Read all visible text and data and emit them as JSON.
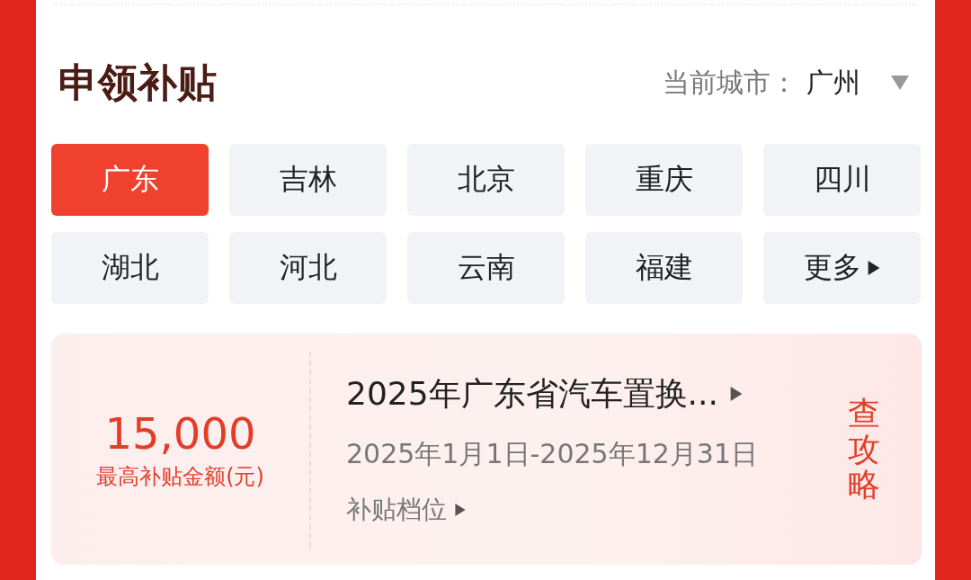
{
  "header": {
    "title": "申领补贴",
    "city_label": "当前城市：",
    "city": "广州"
  },
  "regions": [
    {
      "label": "广东",
      "kind": "region",
      "selected": true
    },
    {
      "label": "吉林",
      "kind": "region",
      "selected": false
    },
    {
      "label": "北京",
      "kind": "region",
      "selected": false
    },
    {
      "label": "重庆",
      "kind": "region",
      "selected": false
    },
    {
      "label": "四川",
      "kind": "region",
      "selected": false
    },
    {
      "label": "湖北",
      "kind": "region",
      "selected": false
    },
    {
      "label": "河北",
      "kind": "region",
      "selected": false
    },
    {
      "label": "云南",
      "kind": "region",
      "selected": false
    },
    {
      "label": "福建",
      "kind": "region",
      "selected": false
    },
    {
      "label": "更多",
      "kind": "more",
      "selected": false
    }
  ],
  "policy": {
    "amount": "15,000",
    "amount_label": "最高补贴金额(元)",
    "title": "2025年广东省汽车置换...",
    "period": "2025年1月1日-2025年12月31日",
    "tiers_link": "补贴档位",
    "guide_button": "查攻略"
  }
}
